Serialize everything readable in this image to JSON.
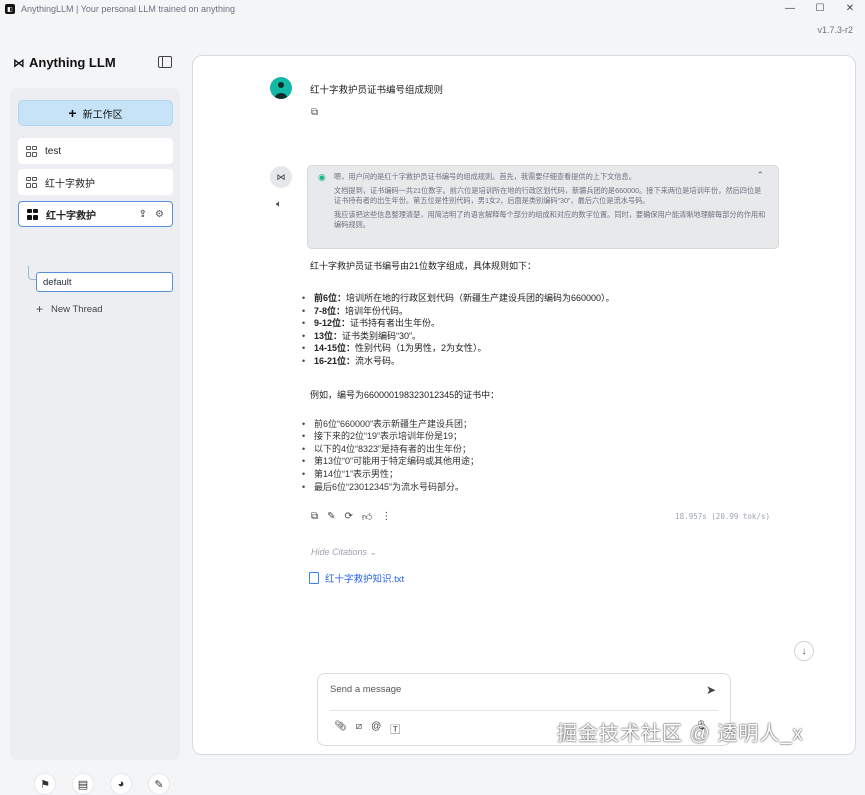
{
  "window": {
    "title": "AnythingLLM | Your personal LLM trained on anything",
    "app_icon": "anythingllm-icon",
    "controls": [
      "—",
      "☐",
      "✕"
    ],
    "version": "v1.7.3-r2"
  },
  "sidebar": {
    "logo": "Anything LLM",
    "new_workspace": "新工作区",
    "workspaces": [
      {
        "label": "test"
      },
      {
        "label": "红十字救护"
      },
      {
        "label": "红十字救护",
        "active": true
      }
    ],
    "thread": "default",
    "new_thread": "New Thread",
    "footer_icons": [
      "community-icon",
      "docs-icon",
      "discord-icon",
      "settings-icon"
    ]
  },
  "chat": {
    "user_message": "红十字救护员证书编号组成规则",
    "thinking": {
      "p1": "嗯，用户问的是红十字救护员证书编号的组成规则。首先，我需要仔细查看提供的上下文信息。",
      "p2": "文档提到，证书编码一共21位数字。前六位是培训所在地的行政区划代码，新疆兵团的是660000。接下来两位是培训年份，然后四位是证书持有者的出生年份。第五位是性别代码，男1女2，后面是类别编码“30”，最后六位是流水号码。",
      "p3": "我应该把这些信息整理清楚，用简洁明了的语言解释每个部分的组成和对应的数字位置。同时，要确保用户能清晰地理解每部分的作用和编码规则。"
    },
    "answer_intro": "红十字救护员证书编号由21位数字组成，具体规则如下：",
    "rules": [
      {
        "bold": "前6位：",
        "text": "培训所在地的行政区划代码（新疆生产建设兵团的编码为660000）。"
      },
      {
        "bold": "7-8位：",
        "text": "培训年份代码。"
      },
      {
        "bold": "9-12位：",
        "text": "证书持有者出生年份。"
      },
      {
        "bold": "13位：",
        "text": "证书类别编码“30”。"
      },
      {
        "bold": "14-15位：",
        "text": "性别代码（1为男性，2为女性）。"
      },
      {
        "bold": "16-21位：",
        "text": "流水号码。"
      }
    ],
    "example_intro": "例如，编号为660000198323012345的证书中：",
    "example_items": [
      "前6位“660000”表示新疆生产建设兵团；",
      "接下来的2位“19”表示培训年份是19；",
      "以下的4位“8323”是持有者的出生年份；",
      "第13位“0”可能用于特定编码或其他用途；",
      "第14位“1”表示男性；",
      "最后6位“23012345”为流水号码部分。"
    ],
    "tokens": "18.957s (20.99 tok/s)",
    "hide_citations": "Hide Citations",
    "citation_file": "红十字救护知识.txt",
    "composer_placeholder": "Send a message"
  },
  "watermark": "掘金技术社区 @ 透明人_x"
}
